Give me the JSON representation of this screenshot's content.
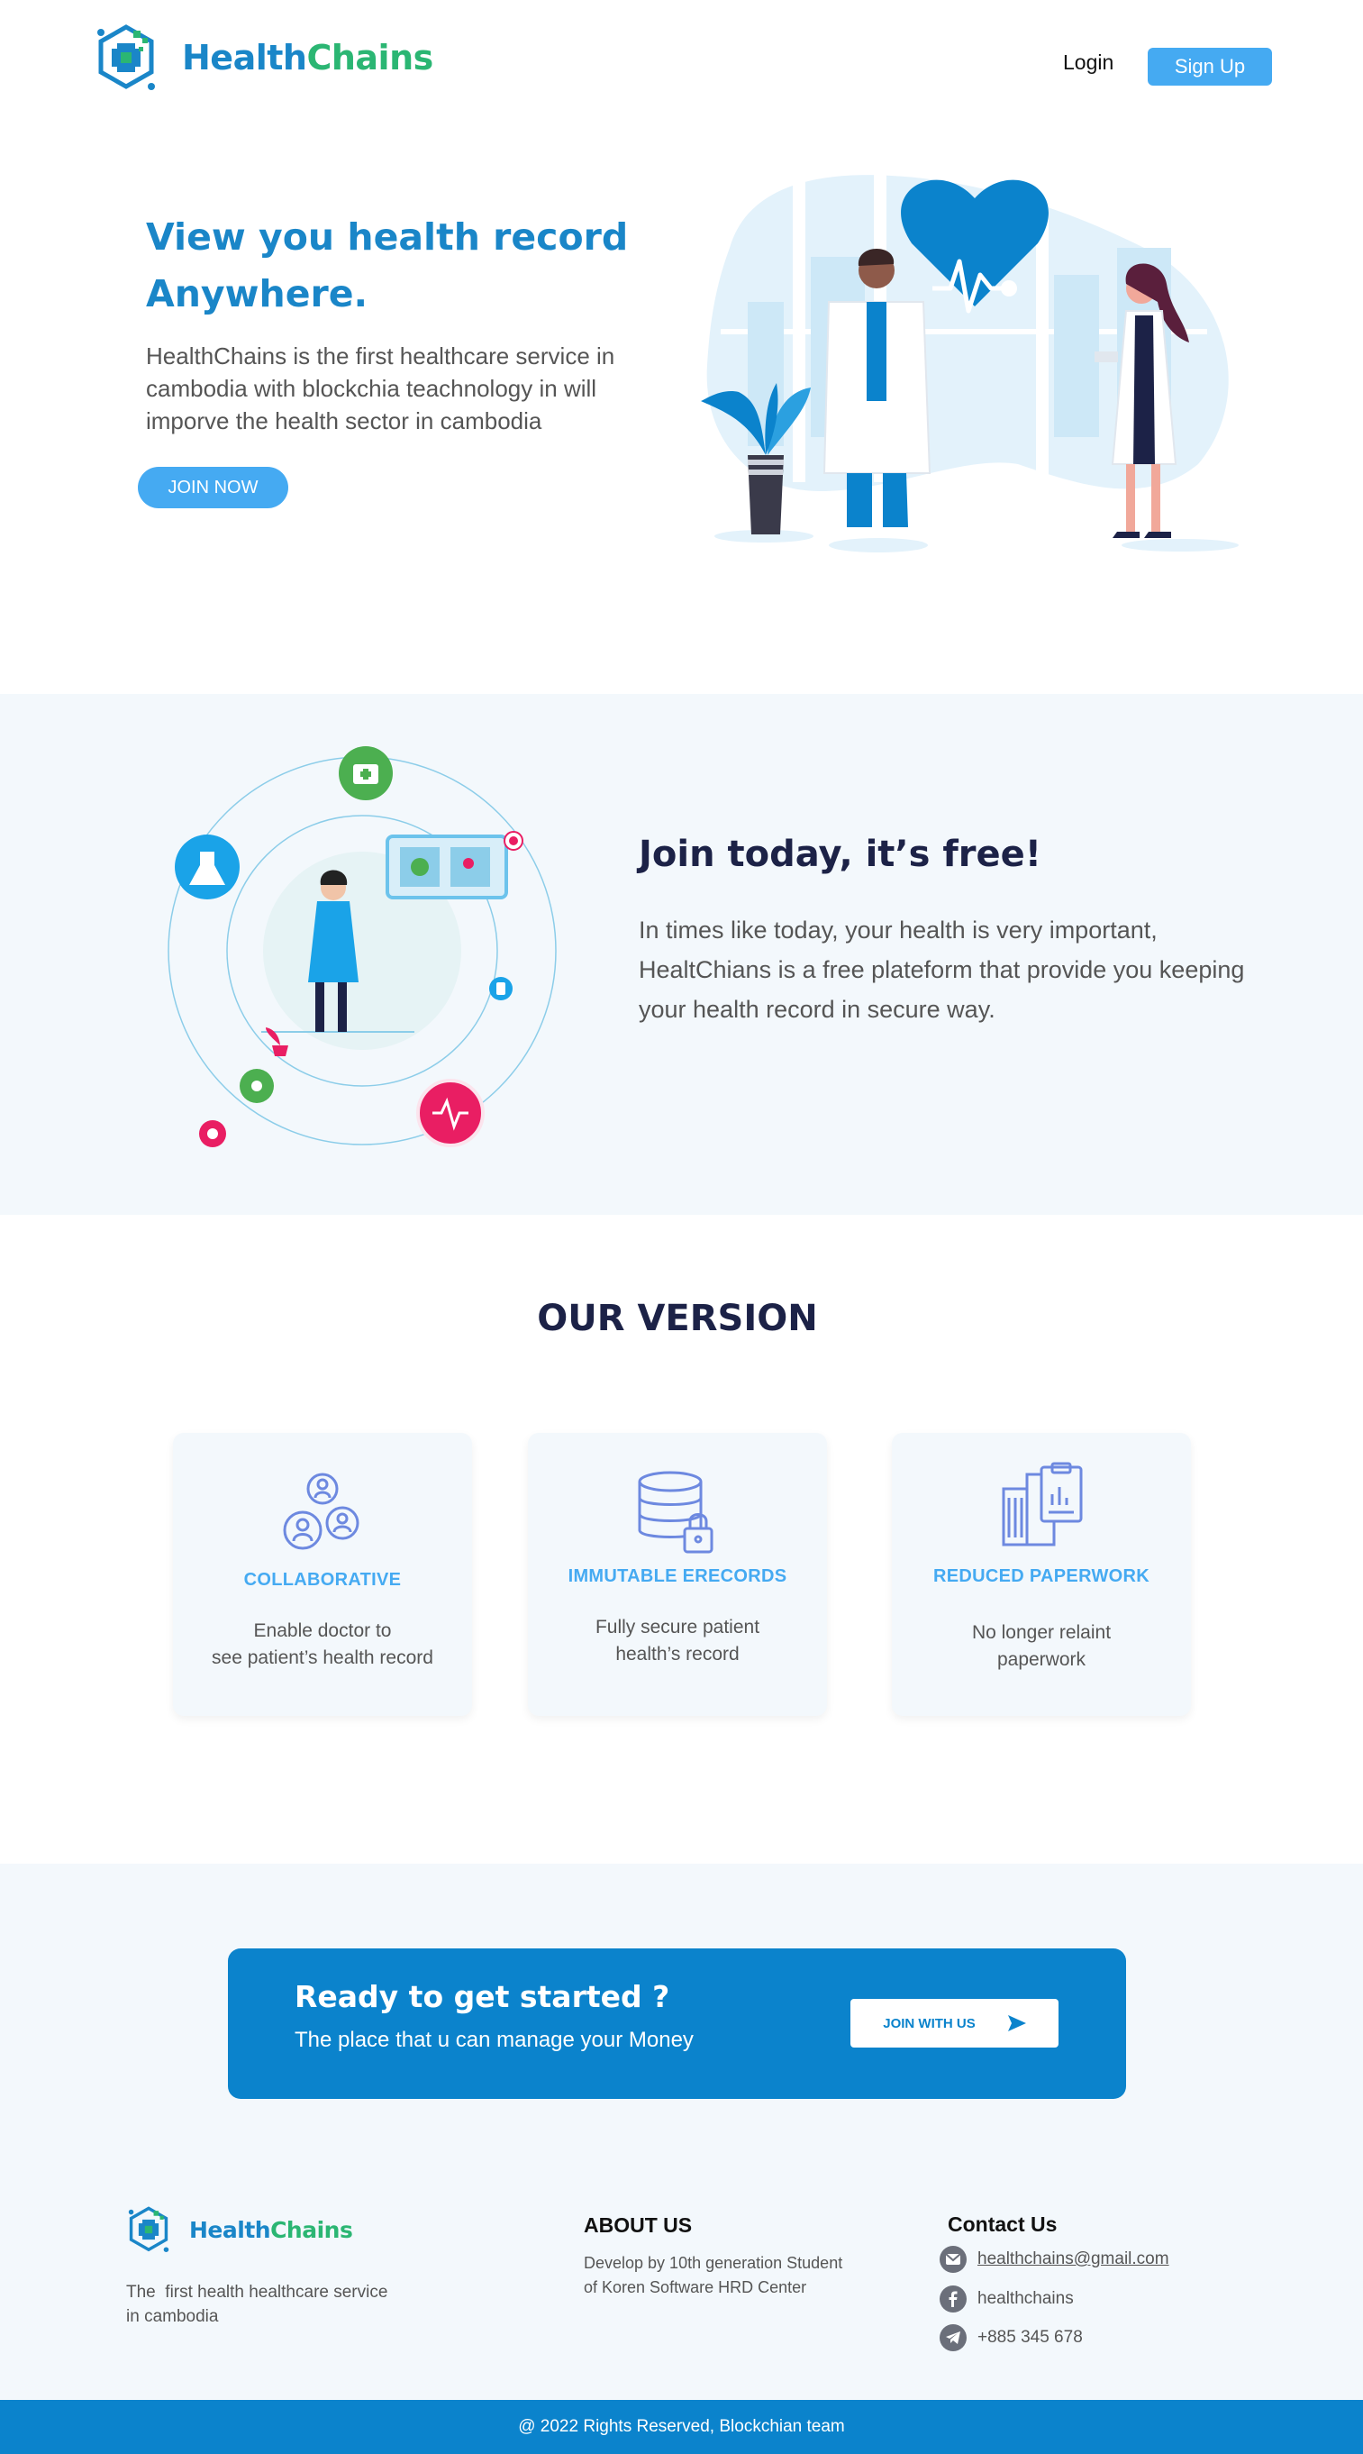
{
  "brand": {
    "name_part1": "Health",
    "name_part2": "Chains"
  },
  "nav": {
    "login": "Login",
    "signup": "Sign Up"
  },
  "hero": {
    "title_line1": "View you health record",
    "title_line2": "Anywhere.",
    "description": "HealthChains is the first healthcare service in cambodia with blockchia teachnology in will imporve the health sector in cambodia",
    "cta": "JOIN NOW"
  },
  "join": {
    "title": "Join today, it’s free!",
    "text": "In times like today, your health is very important, HealtChians is a free plateform that provide you keeping your health record in secure way."
  },
  "version": {
    "title": "OUR VERSION",
    "cards": [
      {
        "icon": "people-network-icon",
        "title": "COLLABORATIVE",
        "text_line1": "Enable doctor to",
        "text_line2": "see patient’s health record"
      },
      {
        "icon": "database-lock-icon",
        "title": "IMMUTABLE ERECORDS",
        "text_line1": "Fully secure patient",
        "text_line2": "health’s record"
      },
      {
        "icon": "clipboard-building-icon",
        "title": "REDUCED PAPERWORK",
        "text_line1": "No longer relaint",
        "text_line2": "paperwork"
      }
    ]
  },
  "cta": {
    "title": "Ready to get started ?",
    "subtitle": "The place that u can manage your Money",
    "button": "JOIN WITH US"
  },
  "footer": {
    "description_line1": "The  first health healthcare service",
    "description_line2": "in cambodia",
    "about_title": "ABOUT US",
    "about_line1": "Develop by 10th generation Student",
    "about_line2": "of Koren Software HRD Center",
    "contact_title": "Contact Us",
    "email": "healthchains@gmail.com",
    "facebook": "healthchains",
    "phone": "+885 345 678",
    "copyright": "@ 2022 Rights Reserved, Blockchian team"
  },
  "colors": {
    "primary": "#1a86c8",
    "accent_green": "#2bb673",
    "button_blue": "#45aaf2",
    "cta_blue": "#0b83cc",
    "dark_navy": "#1c2247",
    "section_bg": "#f3f8fc"
  }
}
